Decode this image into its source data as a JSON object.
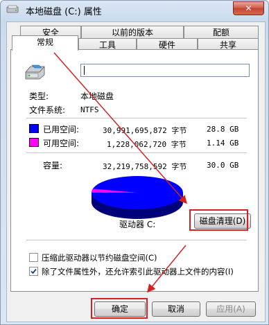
{
  "window": {
    "title": "本地磁盘 (C:) 属性",
    "close_symbol": "✕"
  },
  "tabs_row1": [
    "安全",
    "以前的版本",
    "配额"
  ],
  "tabs_row2": [
    "常规",
    "工具",
    "硬件",
    "共享"
  ],
  "general": {
    "name_value": "",
    "type_label": "类型:",
    "type_value": "本地磁盘",
    "fs_label": "文件系统:",
    "fs_value": "NTFS",
    "used_label": "已用空间:",
    "used_bytes": "30,991,695,872 字节",
    "used_size": "28.8 GB",
    "free_label": "可用空间:",
    "free_bytes": "1,228,062,720 字节",
    "free_size": "1.14 GB",
    "capacity_label": "容量:",
    "capacity_bytes": "32,219,758,592 字节",
    "capacity_size": "30.0 GB",
    "drive_label": "驱动器 C:",
    "cleanup_button": "磁盘清理(D)",
    "compress_label": "压缩此驱动器以节约磁盘空间(C)",
    "compress_checked": false,
    "index_label": "除了文件属性外，还允许索引此驱动器上文件的内容(I)",
    "index_checked": true,
    "colors": {
      "used": "#0000ff",
      "free": "#ff00ff",
      "highlight": "#d22222"
    },
    "pie": {
      "used_fraction": 0.962
    }
  },
  "footer": {
    "ok": "确定",
    "cancel": "取消",
    "apply": "应用(A)"
  }
}
